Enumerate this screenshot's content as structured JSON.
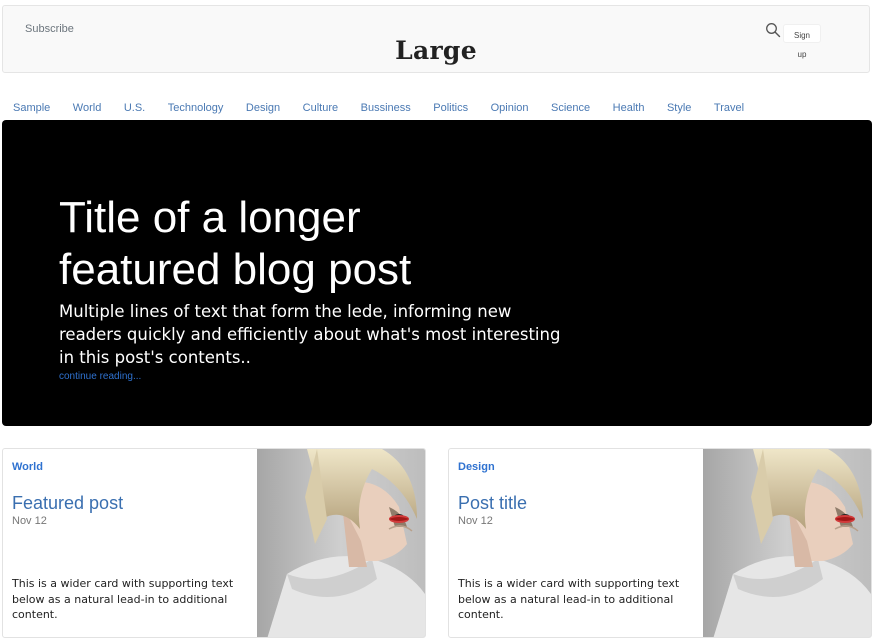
{
  "header": {
    "subscribe": "Subscribe",
    "logo": "Large",
    "signup": "Sign up",
    "search_icon": "search-icon"
  },
  "nav": {
    "items": [
      "Sample",
      "World",
      "U.S.",
      "Technology",
      "Design",
      "Culture",
      "Bussiness",
      "Politics",
      "Opinion",
      "Science",
      "Health",
      "Style",
      "Travel"
    ]
  },
  "hero": {
    "title": "Title of a longer featured blog post",
    "lede": "Multiple lines of text that form the lede, informing new readers quickly and efficiently about what's most interesting in this post's contents..",
    "link": "continue reading..."
  },
  "cards": [
    {
      "category": "World",
      "title": "Featured post",
      "date": "Nov 12",
      "text": "This is a wider card with supporting text below as a natural lead-in to additional content."
    },
    {
      "category": "Design",
      "title": "Post title",
      "date": "Nov 12",
      "text": "This is a wider card with supporting text below as a natural lead-in to additional content."
    }
  ],
  "colors": {
    "link": "#2f72d0",
    "hero_bg": "#000000",
    "header_bg": "#f9f9f9"
  }
}
